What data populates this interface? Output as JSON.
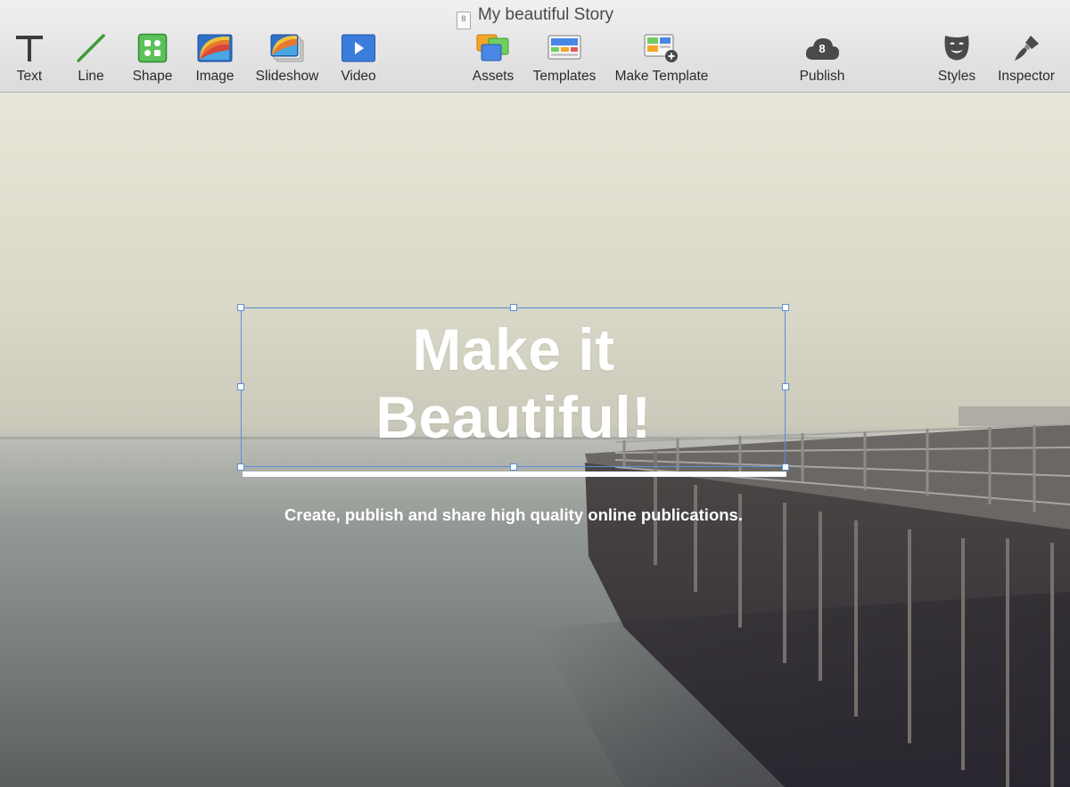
{
  "window": {
    "title": "My beautiful Story",
    "doc_icon_text": "8"
  },
  "toolbar": {
    "left": [
      {
        "label": "Text",
        "icon": "text-icon"
      },
      {
        "label": "Line",
        "icon": "line-icon"
      },
      {
        "label": "Shape",
        "icon": "shape-icon"
      },
      {
        "label": "Image",
        "icon": "image-icon"
      },
      {
        "label": "Slideshow",
        "icon": "slideshow-icon"
      },
      {
        "label": "Video",
        "icon": "video-icon"
      }
    ],
    "center": [
      {
        "label": "Assets",
        "icon": "assets-icon"
      },
      {
        "label": "Templates",
        "icon": "templates-icon"
      },
      {
        "label": "Make Template",
        "icon": "make-template-icon"
      }
    ],
    "publish": {
      "label": "Publish",
      "icon": "cloud-icon",
      "badge": "8"
    },
    "right": [
      {
        "label": "Styles",
        "icon": "mask-icon"
      },
      {
        "label": "Inspector",
        "icon": "brush-icon"
      }
    ]
  },
  "canvas": {
    "headline_line1": "Make it",
    "headline_line2": "Beautiful!",
    "subtitle": "Create, publish and share high quality online publications."
  },
  "colors": {
    "selection": "#5b8fd6",
    "text_on_canvas": "#ffffff"
  }
}
